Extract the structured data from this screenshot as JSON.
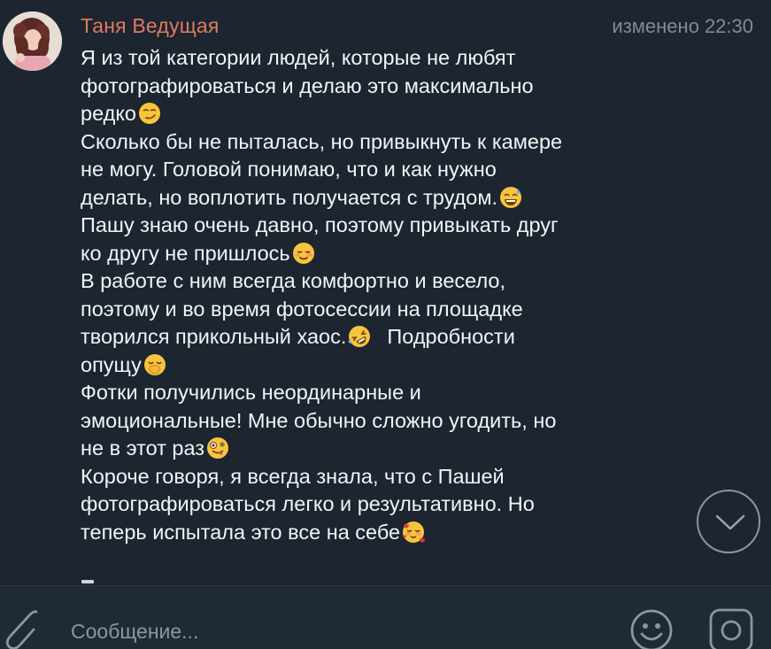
{
  "message": {
    "sender": "Таня Ведущая",
    "edited_label": "изменено",
    "time": "22:30",
    "lines": [
      {
        "text": "Я из той категории людей, которые не любят",
        "emoji": ""
      },
      {
        "text": "фотографироваться и делаю это максимально",
        "emoji": ""
      },
      {
        "text": "редко",
        "emoji": "smirk-emoji"
      },
      {
        "text": "Сколько бы не пыталась, но привыкнуть к камере",
        "emoji": ""
      },
      {
        "text": "не могу. Головой понимаю, что и как нужно",
        "emoji": ""
      },
      {
        "text": "делать, но воплотить получается с трудом.",
        "emoji": "sweat-smile-emoji"
      },
      {
        "text": "Пашу знаю очень давно, поэтому привыкать друг",
        "emoji": ""
      },
      {
        "text": "ко другу не пришлось",
        "emoji": "blush-emoji"
      },
      {
        "text": "В работе с ним всегда комфортно и весело,",
        "emoji": ""
      },
      {
        "text": "поэтому и во время фотосессии на площадке",
        "emoji": ""
      },
      {
        "text": "творился прикольный хаос.",
        "emoji": "rofl-emoji",
        "after": "Подробности"
      },
      {
        "text": "опущу",
        "emoji": "hand-over-mouth-emoji"
      },
      {
        "text": "Фотки получились неординарные и",
        "emoji": ""
      },
      {
        "text": "эмоциональные! Мне обычно сложно угодить, но",
        "emoji": ""
      },
      {
        "text": "не в этот раз",
        "emoji": "zany-face-emoji"
      },
      {
        "text": "Короче говоря, я всегда знала, что с Пашей",
        "emoji": ""
      },
      {
        "text": "фотографироваться легко и результативно. Но",
        "emoji": ""
      },
      {
        "text": "теперь испытала это все на себе",
        "emoji": "smiling-hearts-emoji"
      }
    ]
  },
  "composer": {
    "placeholder": "Сообщение..."
  },
  "icons": {
    "attach": "paperclip-icon",
    "scroll": "chevron-down-icon",
    "emoji": "emoji-smile-icon",
    "camera": "instagram-camera-icon"
  },
  "colors": {
    "background": "#1c2530",
    "sender_name": "#e07a5f",
    "message_text": "#f2f4f6",
    "meta_text": "#7f8b99",
    "icon_gray": "#8b95a1"
  }
}
